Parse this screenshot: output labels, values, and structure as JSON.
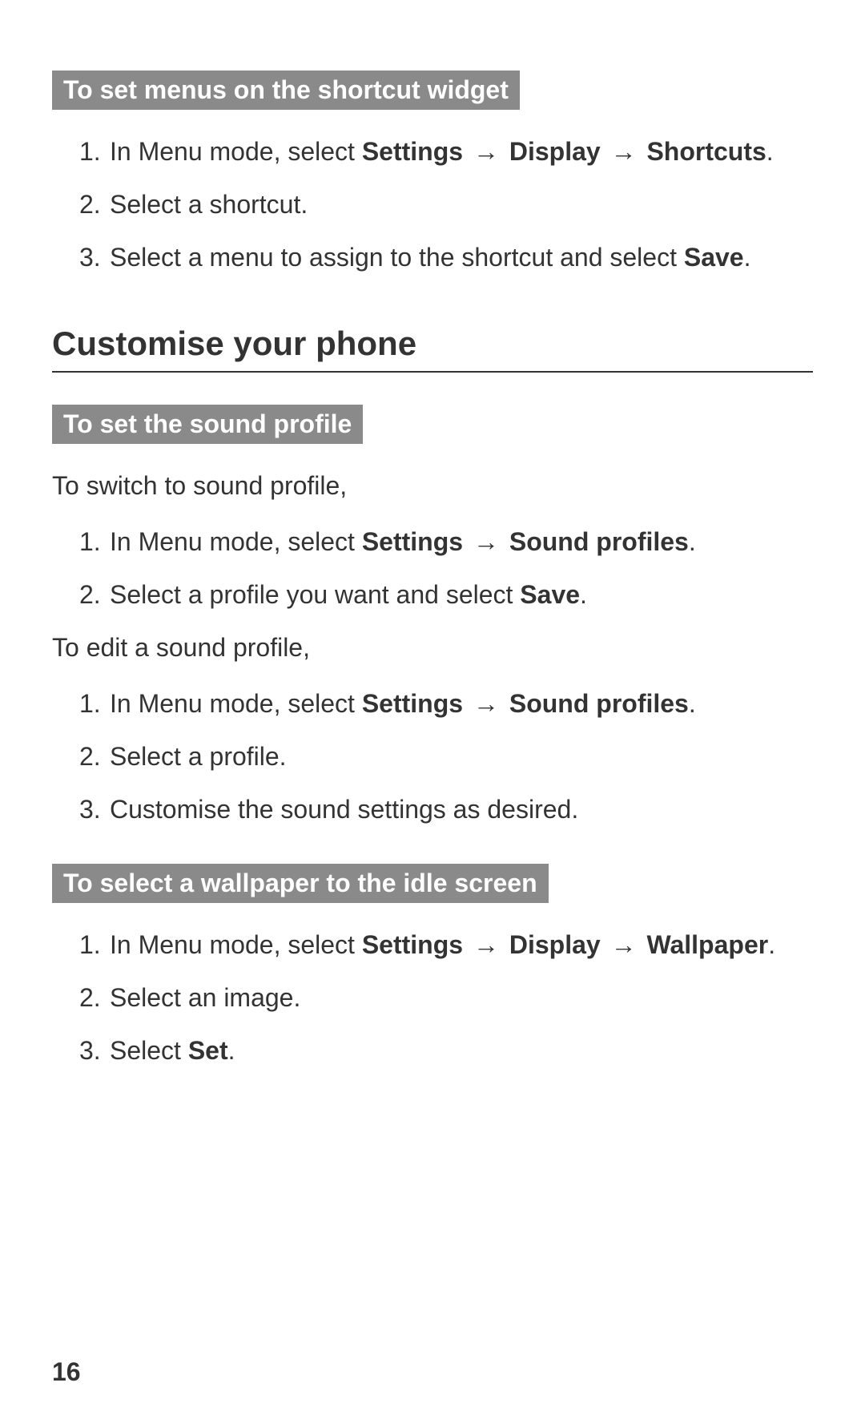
{
  "arrow": "→",
  "sec1": {
    "heading": "To set menus on the shortcut widget",
    "items": [
      {
        "num": "1.",
        "pre": "In Menu mode, select ",
        "path": [
          "Settings",
          "Display",
          "Shortcuts"
        ],
        "post": "."
      },
      {
        "num": "2.",
        "pre": "Select a shortcut.",
        "path": [],
        "post": ""
      },
      {
        "num": "3.",
        "pre": "Select a menu to assign to the shortcut and select ",
        "bold_tail": "Save",
        "post": "."
      }
    ]
  },
  "mainHeading": "Customise your phone",
  "sec2": {
    "heading": "To set the sound profile",
    "intro1": "To switch to sound profile,",
    "list1": [
      {
        "num": "1.",
        "pre": "In Menu mode, select ",
        "path": [
          "Settings",
          "Sound profiles"
        ],
        "post": "."
      },
      {
        "num": "2.",
        "pre": "Select a profile you want and select ",
        "bold_tail": "Save",
        "post": "."
      }
    ],
    "intro2": "To edit a sound profile,",
    "list2": [
      {
        "num": "1.",
        "pre": "In Menu mode, select ",
        "path": [
          "Settings",
          "Sound profiles"
        ],
        "post": "."
      },
      {
        "num": "2.",
        "pre": "Select a profile.",
        "path": [],
        "post": ""
      },
      {
        "num": "3.",
        "pre": "Customise the sound settings as desired.",
        "path": [],
        "post": ""
      }
    ]
  },
  "sec3": {
    "heading": "To select a wallpaper to the idle screen",
    "items": [
      {
        "num": "1.",
        "pre": "In Menu mode, select ",
        "path": [
          "Settings",
          "Display",
          "Wallpaper"
        ],
        "post": "."
      },
      {
        "num": "2.",
        "pre": "Select an image.",
        "path": [],
        "post": ""
      },
      {
        "num": "3.",
        "pre": "Select ",
        "bold_tail": "Set",
        "post": "."
      }
    ]
  },
  "pageNum": "16"
}
